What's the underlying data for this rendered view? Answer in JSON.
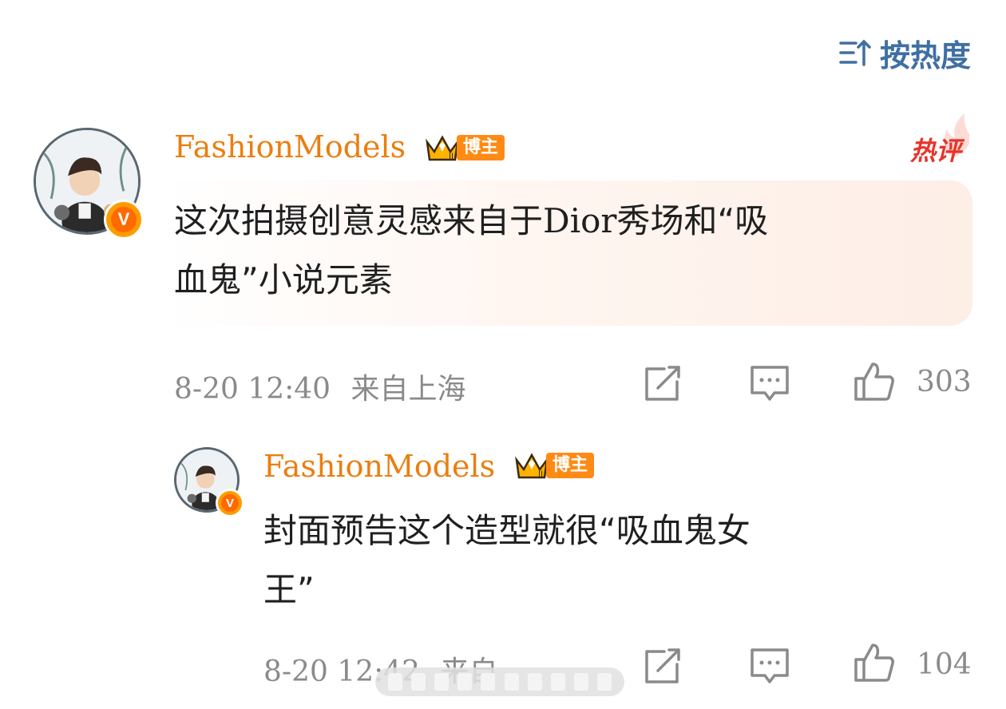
{
  "sort": {
    "label": "按热度",
    "icon": "sort-icon"
  },
  "comments": [
    {
      "username": "FashionModels",
      "badge_label": "博主",
      "hot_label": "热评",
      "text_part1": "这次拍摄创意灵感来自于",
      "text_latin": "Dior",
      "text_part2": "秀场和“吸",
      "text_line2": "血鬼”小说元素",
      "time": "8-20 12:40",
      "location": "来自上海",
      "likes": "303"
    },
    {
      "username": "FashionModels",
      "badge_label": "博主",
      "text_line1": "封面预告这个造型就很“吸血鬼女",
      "text_line2": "王”",
      "time": "8-20 12:42",
      "location": "来自",
      "likes": "104"
    }
  ],
  "colors": {
    "username": "#eb7e10",
    "sort": "#3f6fa3",
    "hot": "#e8332a",
    "meta": "#8a8a8a"
  }
}
